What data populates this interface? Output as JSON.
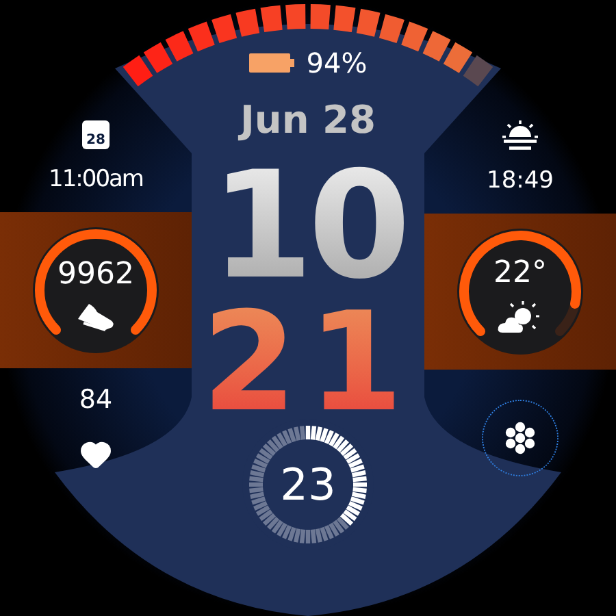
{
  "battery": {
    "level": 0.94,
    "text": "94%"
  },
  "date": "Jun 28",
  "time": {
    "hours": "10",
    "minutes": "21"
  },
  "seconds": {
    "text": "23"
  },
  "left": {
    "calendar_day": "28",
    "event_time": "11:00am",
    "gauge": {
      "kind": "steps",
      "value": "9962"
    },
    "heart_rate": "84"
  },
  "right": {
    "sunset_time": "18:49",
    "gauge": {
      "kind": "weather",
      "value": "22°"
    }
  }
}
